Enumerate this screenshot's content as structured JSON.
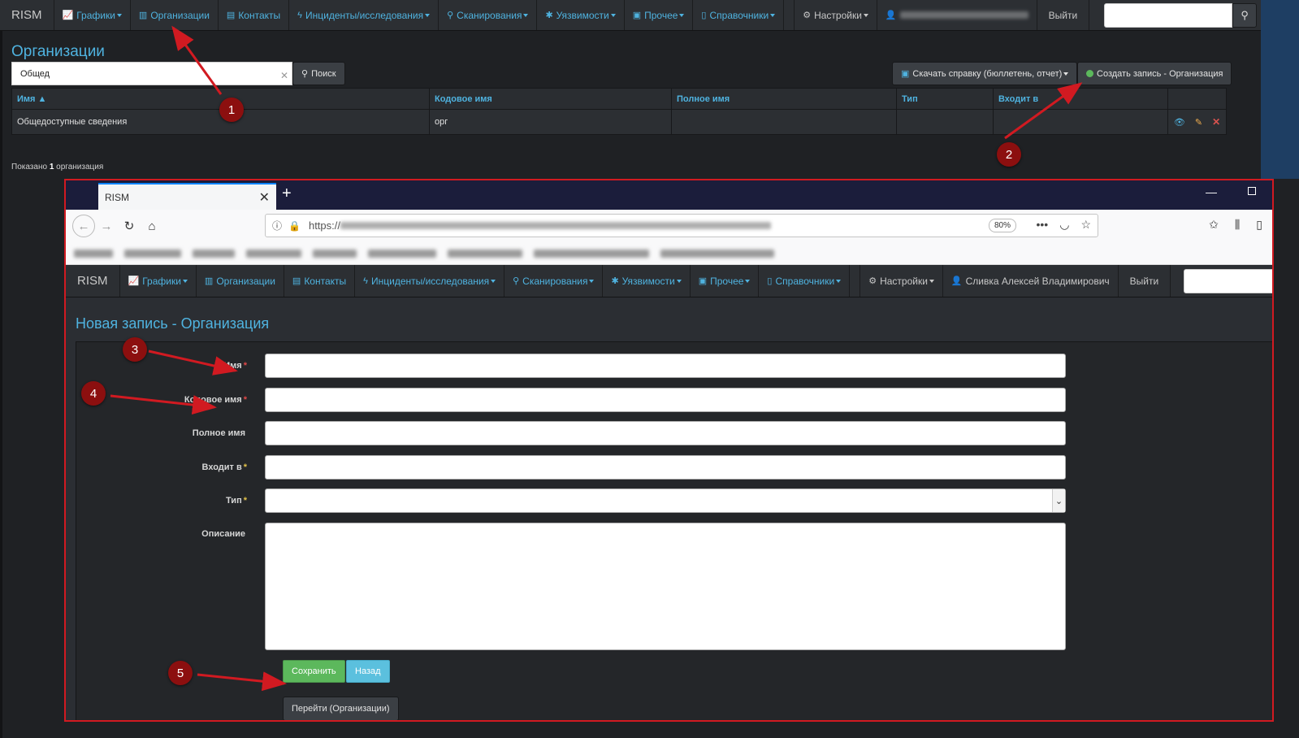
{
  "outer_nav": {
    "brand": "RISM",
    "items": [
      {
        "icon": "chart-icon",
        "label": "Графики",
        "caret": true
      },
      {
        "icon": "building-icon",
        "label": "Организации",
        "caret": false
      },
      {
        "icon": "contact-card-icon",
        "label": "Контакты",
        "caret": false
      },
      {
        "icon": "bolt-icon",
        "label": "Инциденты/исследования",
        "caret": true
      },
      {
        "icon": "search-icon",
        "label": "Сканирования",
        "caret": true
      },
      {
        "icon": "bug-icon",
        "label": "Уязвимости",
        "caret": true
      },
      {
        "icon": "archive-icon",
        "label": "Прочее",
        "caret": true
      },
      {
        "icon": "book-icon",
        "label": "Справочники",
        "caret": true
      }
    ],
    "settings_label": "Настройки",
    "logout_label": "Выйти"
  },
  "outer_page": {
    "title": "Организации",
    "search_value": "Общед",
    "search_button": "Поиск",
    "report_button": "Скачать справку (бюллетень, отчет)",
    "create_button": "Создать запись - Организация",
    "columns": [
      "Имя ▲",
      "Кодовое имя",
      "Полное имя",
      "Тип",
      "Входит в"
    ],
    "rows": [
      {
        "name": "Общедоступные сведения",
        "code": "орг",
        "full": "",
        "type": "",
        "parent": ""
      }
    ],
    "shown_prefix": "Показано",
    "shown_count": "1",
    "shown_suffix": "организация"
  },
  "browser": {
    "tab_title": "RISM",
    "url_scheme": "https://",
    "zoom": "80%"
  },
  "inner_nav": {
    "brand": "RISM",
    "items": [
      {
        "label": "Графики"
      },
      {
        "label": "Организации"
      },
      {
        "label": "Контакты"
      },
      {
        "label": "Инциденты/исследования"
      },
      {
        "label": "Сканирования"
      },
      {
        "label": "Уязвимости"
      },
      {
        "label": "Прочее"
      },
      {
        "label": "Справочники"
      }
    ],
    "settings_label": "Настройки",
    "user_label": "Сливка Алексей Владимирович",
    "logout_label": "Выйти"
  },
  "form": {
    "title": "Новая запись - Организация",
    "fields": [
      {
        "label": "Имя",
        "required": "*"
      },
      {
        "label": "Кодовое имя",
        "required": "*"
      },
      {
        "label": "Полное имя",
        "required": ""
      },
      {
        "label": "Входит в",
        "required": "*"
      },
      {
        "label": "Тип",
        "required": "*"
      },
      {
        "label": "Описание",
        "required": ""
      }
    ],
    "save_button": "Сохранить",
    "back_button": "Назад",
    "goto_button": "Перейти (Организации)"
  },
  "annotations": [
    "1",
    "2",
    "3",
    "4",
    "5"
  ],
  "colors": {
    "accent": "#4fb3e0",
    "highlight_frame": "#d11a21",
    "badge": "#8c0f0f",
    "success": "#5cb85c",
    "info": "#5bc0de"
  }
}
